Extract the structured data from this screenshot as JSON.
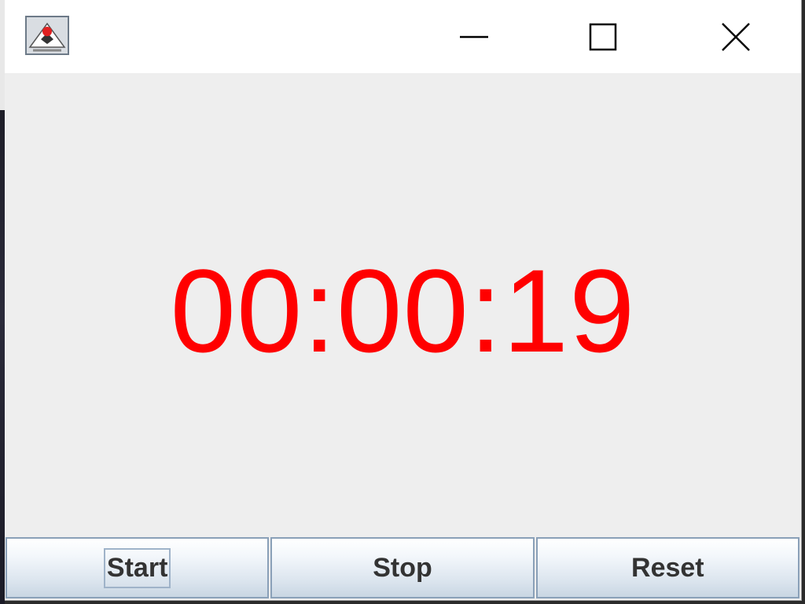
{
  "window": {
    "icon": "java-duke-icon"
  },
  "titlebar_buttons": {
    "minimize_icon": "minimize-icon",
    "maximize_icon": "maximize-icon",
    "close_icon": "close-icon"
  },
  "timer": {
    "display": "00:00:19",
    "color": "#ff0000"
  },
  "buttons": {
    "start_label": "Start",
    "stop_label": "Stop",
    "reset_label": "Reset"
  }
}
